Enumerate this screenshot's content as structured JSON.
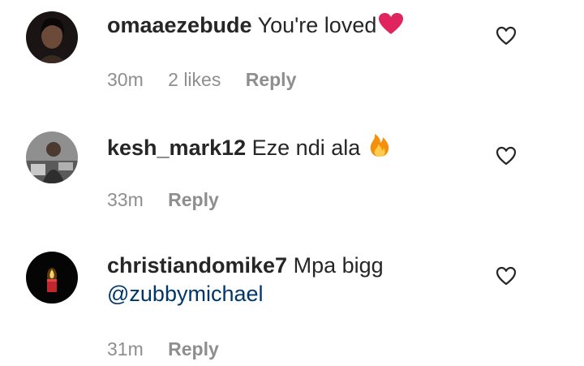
{
  "comments": [
    {
      "username": "omaaezebude",
      "text": "You're loved",
      "emoji": "red-heart-emoji",
      "time": "30m",
      "likes": "2 likes",
      "reply": "Reply"
    },
    {
      "username": "kesh_mark12",
      "text": "Eze ndi ala",
      "emoji": "fire-emoji",
      "time": "33m",
      "reply": "Reply"
    },
    {
      "username": "christiandomike7",
      "text": "Mpa bigg",
      "mention": "@zubbymichael",
      "time": "31m",
      "reply": "Reply"
    }
  ],
  "icons": {
    "like": "heart-outline-icon"
  },
  "colors": {
    "username": "#262626",
    "meta": "#8e8e8e",
    "mention": "#00376b",
    "heart_emoji": "#e0245e",
    "fire_emoji": "#f4900c"
  }
}
